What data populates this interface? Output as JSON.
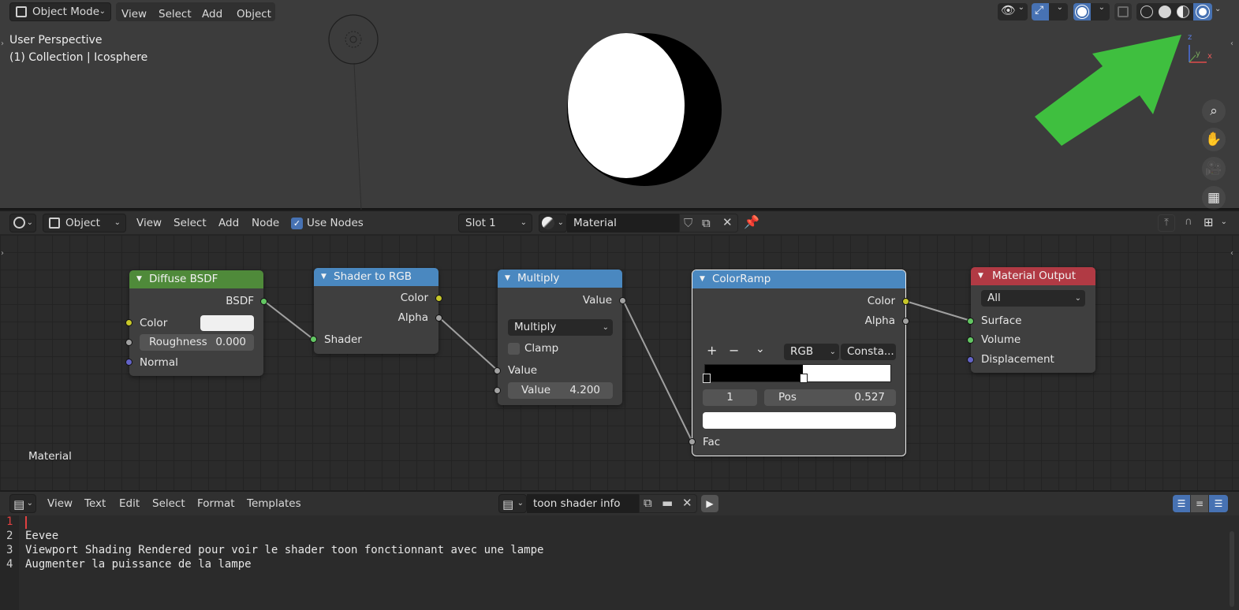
{
  "viewport": {
    "mode_label": "Object Mode",
    "menu": [
      "View",
      "Select",
      "Add",
      "Object"
    ],
    "overlay_perspective": "User Perspective",
    "overlay_collection": "(1) Collection | Icosphere",
    "axis_labels": {
      "z": "z",
      "y": "y",
      "x": "x"
    },
    "accent_arrow_color": "#3fbf3f",
    "nav_icons": [
      "zoom-icon",
      "hand-pan-icon",
      "camera-icon",
      "grid-ortho-icon"
    ]
  },
  "node_editor": {
    "editor_type": "Object",
    "menu": [
      "View",
      "Select",
      "Add",
      "Node"
    ],
    "use_nodes_label": "Use Nodes",
    "use_nodes_checked": true,
    "slot_label": "Slot 1",
    "material_name": "Material",
    "tree_label": "Material",
    "nodes": {
      "diffuse": {
        "title": "Diffuse BSDF",
        "out_bsdf": "BSDF",
        "in_color": "Color",
        "roughness_label": "Roughness",
        "roughness_value": "0.000",
        "in_normal": "Normal"
      },
      "shader_to_rgb": {
        "title": "Shader to RGB",
        "out_color": "Color",
        "out_alpha": "Alpha",
        "in_shader": "Shader"
      },
      "multiply": {
        "title": "Multiply",
        "out_value": "Value",
        "operation": "Multiply",
        "clamp_label": "Clamp",
        "in_value": "Value",
        "value_label": "Value",
        "value_number": "4.200"
      },
      "colorramp": {
        "title": "ColorRamp",
        "out_color": "Color",
        "out_alpha": "Alpha",
        "plus": "+",
        "minus": "−",
        "down": "⌄",
        "color_mode": "RGB",
        "interpolation": "Consta...",
        "stop_index": "1",
        "pos_label": "Pos",
        "pos_value": "0.527",
        "in_fac": "Fac"
      },
      "output": {
        "title": "Material Output",
        "target": "All",
        "in_surface": "Surface",
        "in_volume": "Volume",
        "in_displacement": "Displacement"
      }
    }
  },
  "text_editor": {
    "menu": [
      "View",
      "Text",
      "Edit",
      "Select",
      "Format",
      "Templates"
    ],
    "file_name": "toon shader info",
    "line_numbers": [
      "1",
      "2",
      "3",
      "4"
    ],
    "lines": [
      "",
      "Eevee",
      "Viewport Shading Rendered pour voir le shader toon fonctionnant avec une lampe",
      "Augmenter la puissance de la lampe"
    ]
  }
}
